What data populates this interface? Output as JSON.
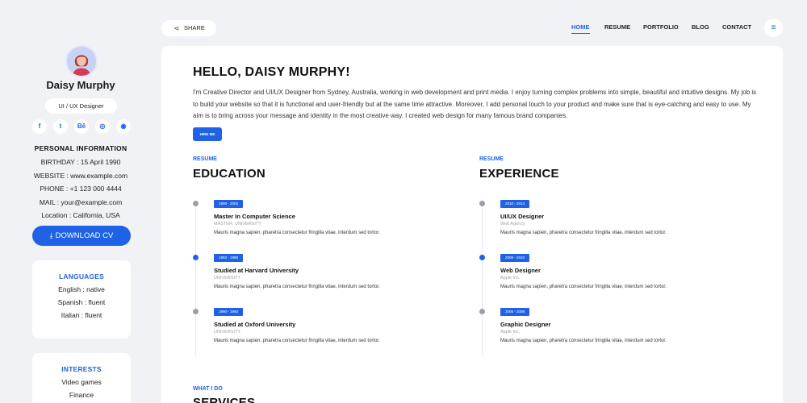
{
  "profile": {
    "name": "Daisy Murphy",
    "role": "UI / UX Designer",
    "social": [
      {
        "icon": "facebook-icon",
        "glyph": "f"
      },
      {
        "icon": "twitter-icon",
        "glyph": "t"
      },
      {
        "icon": "behance-icon",
        "glyph": "Bē"
      },
      {
        "icon": "dribbble-icon",
        "glyph": "◎"
      },
      {
        "icon": "github-icon",
        "glyph": "◉"
      }
    ]
  },
  "personal": {
    "title": "PERSONAL INFORMATION",
    "lines": [
      "BIRTHDAY : 15 April 1990",
      "WEBSITE : www.example.com",
      "PHONE : +1 123 000 4444",
      "MAIL : your@example.com",
      "Location : California, USA"
    ]
  },
  "download": {
    "label": "DOWNLOAD CV",
    "icon": "download-icon"
  },
  "languages": {
    "title": "LANGUAGES",
    "items": [
      "English : native",
      "Spanish : fluent",
      "Italian : fluent"
    ]
  },
  "interests": {
    "title": "INTERESTS",
    "items": [
      "Video games",
      "Finance"
    ]
  },
  "topbar": {
    "share_label": "SHARE",
    "nav": [
      "HOME",
      "RESUME",
      "PORTFOLIO",
      "BLOG",
      "CONTACT"
    ],
    "active": "HOME"
  },
  "main": {
    "greeting": "HELLO, DAISY MURPHY!",
    "intro": "I'm Creative Director and UI/UX Designer from Sydney, Australia, working in web development and print media. I enjoy turning complex problems into simple, beautiful and intuitive designs. My job is to build your website so that it is functional and user-friendly but at the same time attractive. Moreover, I add personal touch to your product and make sure that is eye-catching and easy to use. My aim is to bring across your message and identity in the most creative way. I created web design for many famous brand companies.",
    "hire_label": "HIRE ME",
    "education": {
      "kicker": "RESUME",
      "title": "EDUCATION",
      "entries": [
        {
          "date": "1998 - 2003",
          "title": "Master In Computer Science",
          "sub": "MASTER, UNIVERSITY",
          "desc": "Mauris magna sapien, pharetra consectetur fringilla vitae, interdum sed tortor."
        },
        {
          "date": "1993 - 1998",
          "title": "Studied at Harvard University",
          "sub": "UNIVERSITY",
          "desc": "Mauris magna sapien, pharetra consectetur fringilla vitae, interdum sed tortor."
        },
        {
          "date": "1990 - 1993",
          "title": "Studied at Oxford University",
          "sub": "UNIVERSITY",
          "desc": "Mauris magna sapien, pharetra consectetur fringilla vitae, interdum sed tortor."
        }
      ]
    },
    "experience": {
      "kicker": "RESUME",
      "title": "EXPERIENCE",
      "entries": [
        {
          "date": "2010 - 2014",
          "title": "UI/UX Designer",
          "sub": "Web Agency",
          "desc": "Mauris magna sapien, pharetra consectetur fringilla vitae, interdum sed tortor."
        },
        {
          "date": "2008 - 2010",
          "title": "Web Designer",
          "sub": "Apple Inc.",
          "desc": "Mauris magna sapien, pharetra consectetur fringilla vitae, interdum sed tortor."
        },
        {
          "date": "2006 - 2008",
          "title": "Graphic Designer",
          "sub": "Apple Inc.",
          "desc": "Mauris magna sapien, pharetra consectetur fringilla vitae, interdum sed tortor."
        }
      ]
    },
    "services": {
      "kicker": "WHAT I DO",
      "title": "SERVICES"
    }
  },
  "colors": {
    "accent": "#2062e6",
    "background": "#f1f2f6",
    "card": "#ffffff"
  }
}
